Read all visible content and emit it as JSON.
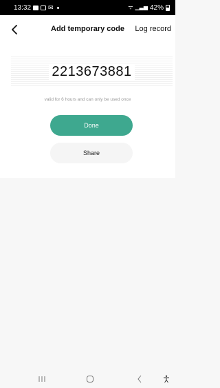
{
  "status_bar": {
    "time": "13:32",
    "battery": "42%"
  },
  "header": {
    "title": "Add temporary code",
    "log_record_label": "Log record"
  },
  "code": {
    "value": "2213673881",
    "validity_note": "valid for 6 hours and can only be used once"
  },
  "buttons": {
    "done_label": "Done",
    "share_label": "Share"
  },
  "colors": {
    "accent": "#3ea88f",
    "status_bar_bg": "#000000",
    "page_bg": "#f7f7f7"
  },
  "icons": {
    "back": "chevron-left-icon",
    "nav_recents": "recents-icon",
    "nav_home": "home-icon",
    "nav_back": "back-icon",
    "nav_accessibility": "accessibility-icon"
  }
}
